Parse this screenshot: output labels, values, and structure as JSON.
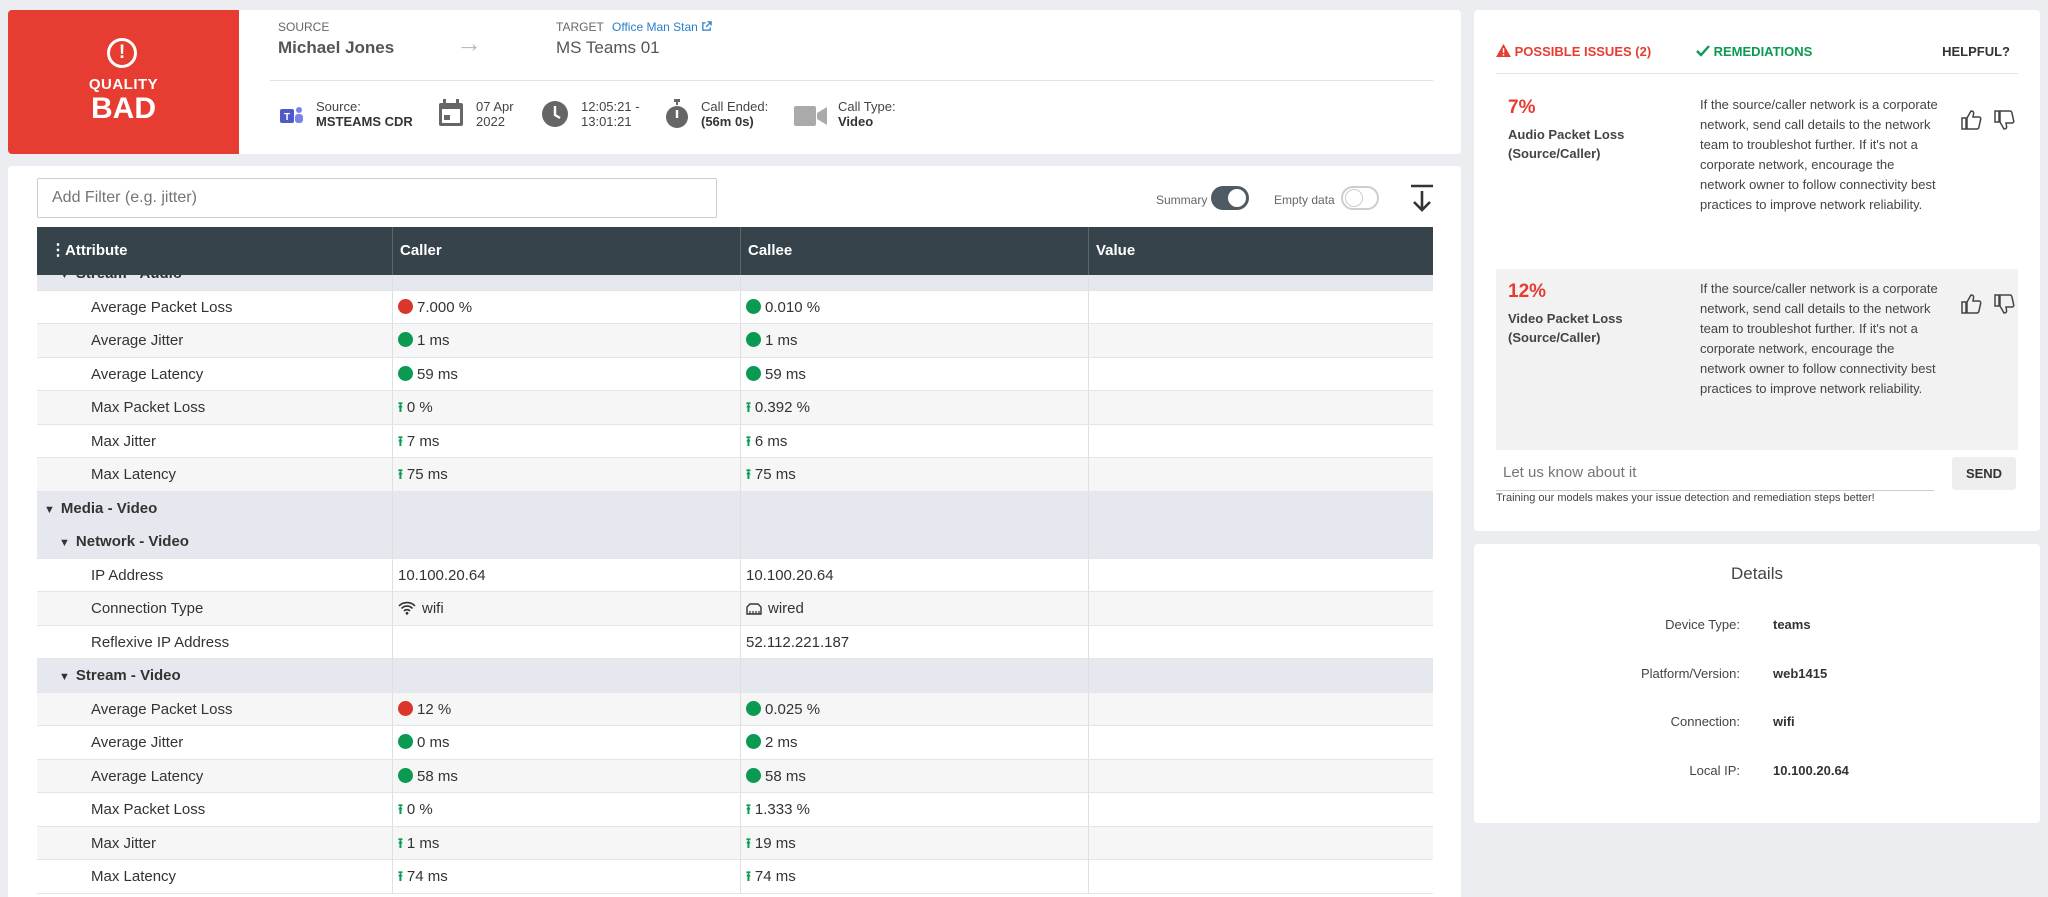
{
  "quality": {
    "label": "QUALITY",
    "value": "BAD"
  },
  "source": {
    "caption": "SOURCE",
    "name": "Michael Jones"
  },
  "target": {
    "caption": "TARGET",
    "link": "Office Man Stan",
    "name": "MS Teams 01"
  },
  "meta": {
    "source_label": "Source:",
    "source_value": "MSTEAMS CDR",
    "date_line1": "07 Apr",
    "date_line2": "2022",
    "time_line1": "12:05:21 -",
    "time_line2": "13:01:21",
    "ended_label": "Call Ended:",
    "ended_value": "(56m 0s)",
    "type_label": "Call Type:",
    "type_value": "Video"
  },
  "filter": {
    "placeholder": "Add Filter (e.g. jitter)"
  },
  "toggles": {
    "summary": "Summary",
    "empty": "Empty data"
  },
  "columns": [
    "Attribute",
    "Caller",
    "Callee",
    "Value"
  ],
  "rows": [
    {
      "kind": "group",
      "level": 2,
      "label": "Stream - Audio"
    },
    {
      "kind": "data",
      "label": "Average Packet Loss",
      "caller": "7.000 %",
      "caller_ind": "red",
      "callee": "0.010 %",
      "callee_ind": "green"
    },
    {
      "kind": "data",
      "label": "Average Jitter",
      "caller": "1 ms",
      "caller_ind": "green",
      "callee": "1 ms",
      "callee_ind": "green"
    },
    {
      "kind": "data",
      "label": "Average Latency",
      "caller": "59 ms",
      "caller_ind": "green",
      "callee": "59 ms",
      "callee_ind": "green"
    },
    {
      "kind": "data",
      "label": "Max Packet Loss",
      "caller": "0 %",
      "caller_ind": "up",
      "callee": "0.392 %",
      "callee_ind": "up"
    },
    {
      "kind": "data",
      "label": "Max Jitter",
      "caller": "7 ms",
      "caller_ind": "up",
      "callee": "6 ms",
      "callee_ind": "up"
    },
    {
      "kind": "data",
      "label": "Max Latency",
      "caller": "75 ms",
      "caller_ind": "up",
      "callee": "75 ms",
      "callee_ind": "up"
    },
    {
      "kind": "group",
      "level": 1,
      "label": "Media - Video"
    },
    {
      "kind": "group",
      "level": 2,
      "label": "Network - Video"
    },
    {
      "kind": "data",
      "label": "IP Address",
      "caller": "10.100.20.64",
      "caller_ind": "",
      "callee": "10.100.20.64",
      "callee_ind": ""
    },
    {
      "kind": "data",
      "label": "Connection Type",
      "caller": "wifi",
      "caller_ind": "wifi",
      "callee": "wired",
      "callee_ind": "wired"
    },
    {
      "kind": "data",
      "label": "Reflexive IP Address",
      "caller": "",
      "caller_ind": "",
      "callee": "52.112.221.187",
      "callee_ind": ""
    },
    {
      "kind": "group",
      "level": 2,
      "label": "Stream - Video"
    },
    {
      "kind": "data",
      "label": "Average Packet Loss",
      "caller": "12 %",
      "caller_ind": "red",
      "callee": "0.025 %",
      "callee_ind": "green"
    },
    {
      "kind": "data",
      "label": "Average Jitter",
      "caller": "0 ms",
      "caller_ind": "green",
      "callee": "2 ms",
      "callee_ind": "green"
    },
    {
      "kind": "data",
      "label": "Average Latency",
      "caller": "58 ms",
      "caller_ind": "green",
      "callee": "58 ms",
      "callee_ind": "green"
    },
    {
      "kind": "data",
      "label": "Max Packet Loss",
      "caller": "0 %",
      "caller_ind": "up",
      "callee": "1.333 %",
      "callee_ind": "up"
    },
    {
      "kind": "data",
      "label": "Max Jitter",
      "caller": "1 ms",
      "caller_ind": "up",
      "callee": "19 ms",
      "callee_ind": "up"
    },
    {
      "kind": "data",
      "label": "Max Latency",
      "caller": "74 ms",
      "caller_ind": "up",
      "callee": "74 ms",
      "callee_ind": "up"
    }
  ],
  "issues": {
    "header_issues": "POSSIBLE ISSUES (2)",
    "header_remediations": "REMEDIATIONS",
    "header_helpful": "HELPFUL?",
    "items": [
      {
        "pct": "7%",
        "title": "Audio Packet Loss (Source/Caller)",
        "desc": "If the source/caller network is a corporate network, send call details to the network team to troubleshot further. If it's not a corporate network, encourage the network owner to follow connectivity best practices to improve network reliability."
      },
      {
        "pct": "12%",
        "title": "Video Packet Loss (Source/Caller)",
        "desc": "If the source/caller network is a corporate network, send call details to the network team to troubleshot further. If it's not a corporate network, encourage the network owner to follow connectivity best practices to improve network reliability."
      }
    ],
    "feedback_placeholder": "Let us know about it",
    "send": "SEND",
    "training": "Training our models makes your issue detection and remediation steps better!"
  },
  "details": {
    "title": "Details",
    "rows": [
      {
        "k": "Device Type:",
        "v": "teams"
      },
      {
        "k": "Platform/Version:",
        "v": "web1415"
      },
      {
        "k": "Connection:",
        "v": "wifi"
      },
      {
        "k": "Local IP:",
        "v": "10.100.20.64"
      }
    ]
  },
  "colors": {
    "bad": "#e63c32",
    "good": "#0b9a52",
    "header_dark": "#36434a",
    "link": "#2a7ec9"
  }
}
